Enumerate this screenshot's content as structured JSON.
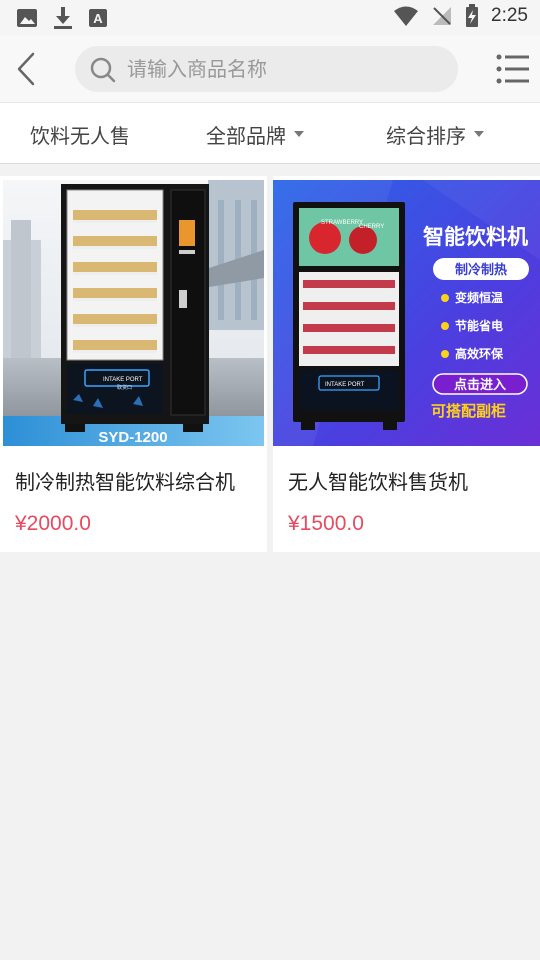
{
  "status_bar": {
    "time": "2:25",
    "left_icons": [
      "image-icon",
      "download-icon",
      "font-a-icon"
    ],
    "right_icons": [
      "wifi-icon",
      "signal-off-icon",
      "battery-charging-icon"
    ]
  },
  "header": {
    "back_icon": "chevron-left-icon",
    "search_placeholder": "请输入商品名称",
    "menu_icon": "list-menu-icon"
  },
  "filters": [
    {
      "label": "饮料无人售",
      "has_caret": false
    },
    {
      "label": "全部品牌",
      "has_caret": true
    },
    {
      "label": "综合排序",
      "has_caret": true
    }
  ],
  "products": [
    {
      "title": "制冷制热智能饮料综合机",
      "price": "¥2000.0",
      "image": {
        "model_label": "SYD-1200",
        "port_label": "INTAKE PORT",
        "port_sublabel": "取货口"
      }
    },
    {
      "title": "无人智能饮料售货机",
      "price": "¥1500.0",
      "image": {
        "headline": "智能饮料机",
        "badge": "制冷制热",
        "features": [
          "变频恒温",
          "节能省电",
          "高效环保"
        ],
        "cta": "点击进入",
        "footer": "可搭配副柜",
        "port_label": "INTAKE PORT",
        "screen_tags": [
          "STRAWBERRY",
          "CHERRY"
        ]
      }
    }
  ],
  "colors": {
    "price": "#e84a5f",
    "banner_blue": "#2a66e8",
    "banner_purple": "#6a2fd6",
    "accent_yellow": "#ffd21a"
  }
}
